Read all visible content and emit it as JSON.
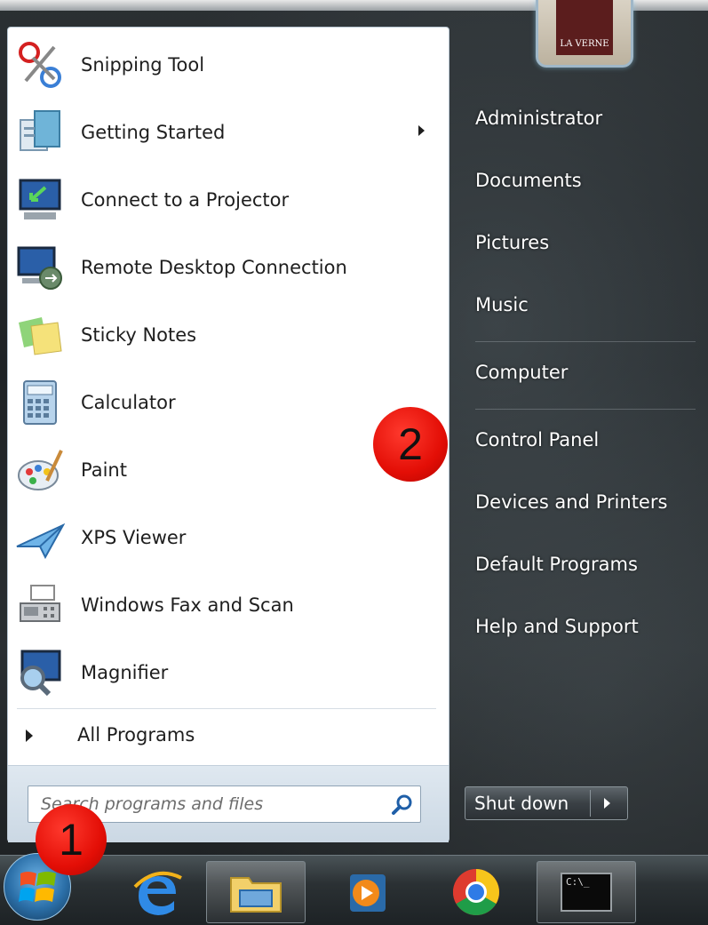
{
  "pinned_programs": [
    {
      "label": "Snipping Tool",
      "icon": "scissors-icon",
      "has_submenu": false
    },
    {
      "label": "Getting Started",
      "icon": "getting-started-icon",
      "has_submenu": true
    },
    {
      "label": "Connect to a Projector",
      "icon": "projector-icon",
      "has_submenu": false
    },
    {
      "label": "Remote Desktop Connection",
      "icon": "remote-desktop-icon",
      "has_submenu": false
    },
    {
      "label": "Sticky Notes",
      "icon": "sticky-notes-icon",
      "has_submenu": false
    },
    {
      "label": "Calculator",
      "icon": "calculator-icon",
      "has_submenu": false
    },
    {
      "label": "Paint",
      "icon": "paint-palette-icon",
      "has_submenu": false
    },
    {
      "label": "XPS Viewer",
      "icon": "paper-plane-icon",
      "has_submenu": false
    },
    {
      "label": "Windows Fax and Scan",
      "icon": "fax-machine-icon",
      "has_submenu": false
    },
    {
      "label": "Magnifier",
      "icon": "magnifier-icon",
      "has_submenu": false
    }
  ],
  "all_programs_label": "All Programs",
  "search": {
    "placeholder": "Search programs and files",
    "value": ""
  },
  "user_picture_text": "LA VERNE",
  "right_menu": [
    {
      "label": "Administrator"
    },
    {
      "label": "Documents"
    },
    {
      "label": "Pictures"
    },
    {
      "label": "Music"
    },
    {
      "label": "Computer"
    },
    {
      "label": "Control Panel"
    },
    {
      "label": "Devices and Printers"
    },
    {
      "label": "Default Programs"
    },
    {
      "label": "Help and Support"
    }
  ],
  "shutdown_label": "Shut down",
  "taskbar": [
    {
      "name": "start-button",
      "icon": "windows-logo-icon"
    },
    {
      "name": "internet-explorer",
      "icon": "internet-explorer-icon"
    },
    {
      "name": "windows-explorer",
      "icon": "folder-icon"
    },
    {
      "name": "media-player",
      "icon": "media-player-icon"
    },
    {
      "name": "google-chrome",
      "icon": "chrome-icon"
    },
    {
      "name": "command-prompt",
      "icon": "command-prompt-icon"
    }
  ],
  "cmd_icon_text": "C:\\_",
  "callouts": [
    "1",
    "2"
  ],
  "colors": {
    "callout_red": "#e30e06",
    "menu_white": "#ffffff",
    "taskbar_dark": "#2b3134"
  }
}
